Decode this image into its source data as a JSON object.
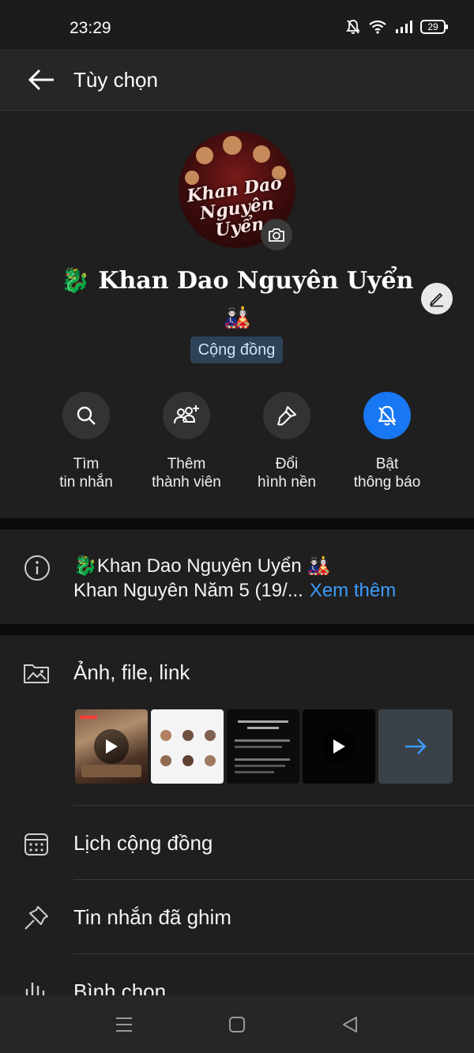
{
  "status_bar": {
    "time": "23:29",
    "battery": "29"
  },
  "app_bar": {
    "title": "Tùy chọn"
  },
  "group": {
    "name": "🐉 Khan Dao Nguyên Uyển",
    "name_emoji": "🎎",
    "badge": "Cộng đồng",
    "avatar_text_line1": "Khan Dao",
    "avatar_text_line2": "Nguyên Uyển"
  },
  "actions": [
    {
      "label1": "Tìm",
      "label2": "tin nhắn",
      "icon": "search-icon"
    },
    {
      "label1": "Thêm",
      "label2": "thành viên",
      "icon": "add-people-icon"
    },
    {
      "label1": "Đổi",
      "label2": "hình nền",
      "icon": "paint-brush-icon"
    },
    {
      "label1": "Bật",
      "label2": "thông báo",
      "icon": "bell-off-icon"
    }
  ],
  "info": {
    "line1": "🐉Khan Dao Nguyên Uyển 🎎",
    "line2": "Khan Nguyên Năm 5 (19/...",
    "see_more": "Xem thêm"
  },
  "menu": {
    "media": "Ảnh, file, link",
    "calendar": "Lịch cộng đồng",
    "pinned": "Tin nhắn đã ghim",
    "poll": "Bình chọn"
  },
  "colors": {
    "accent": "#1877f2",
    "link": "#3b9bff",
    "badge_bg": "#2e4257",
    "background": "#1f1f1f"
  }
}
